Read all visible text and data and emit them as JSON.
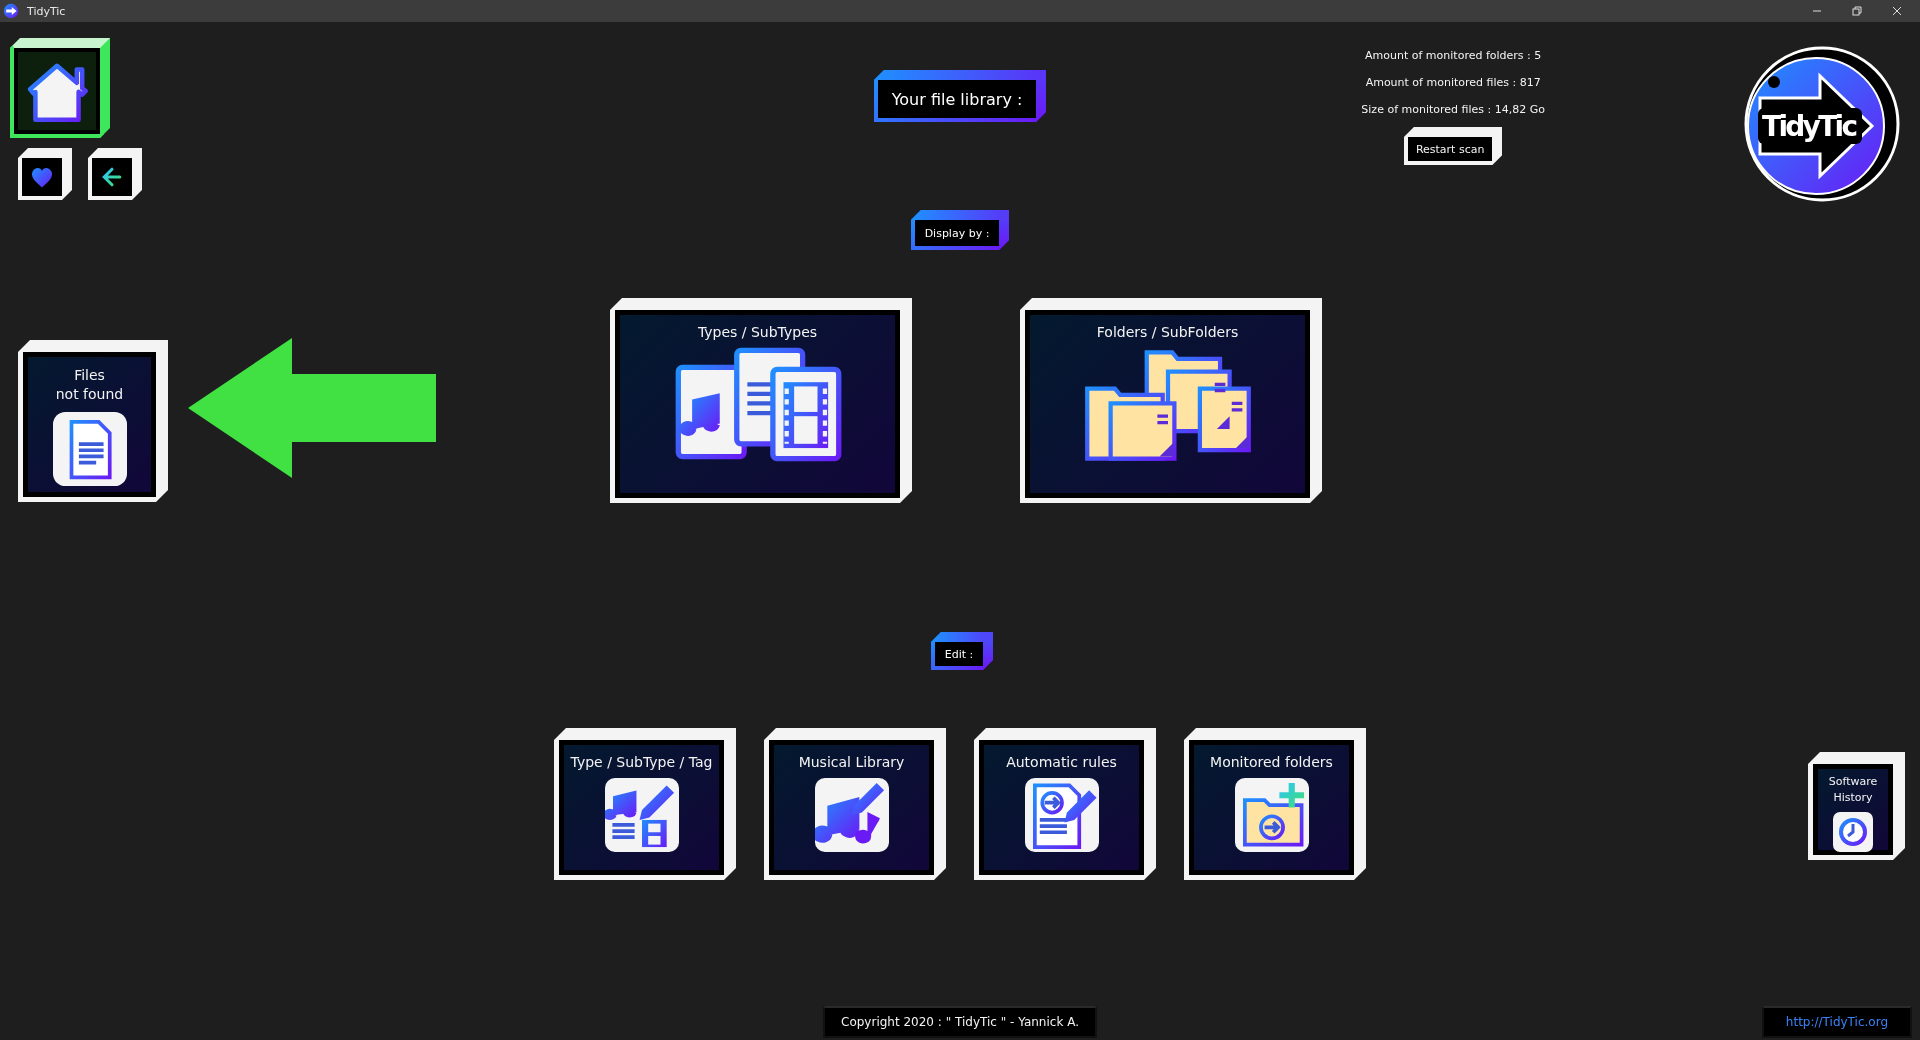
{
  "window": {
    "title": "TidyTic"
  },
  "nav": [
    {
      "kind": "home",
      "selected": true
    },
    {
      "kind": "favorites",
      "selected": false
    },
    {
      "kind": "back",
      "selected": false
    }
  ],
  "library_heading": "Your file library :",
  "stats": [
    "Amount of monitored folders : 5",
    "Amount of monitored files : 817",
    "Size of monitored files : 14,82 Go"
  ],
  "restart_button": "Restart scan",
  "logo": {
    "text": "TidyTic"
  },
  "display_heading": "Display by :",
  "files_not_found": {
    "label": "Files\nnot found"
  },
  "display_options": [
    {
      "kind": "types",
      "label": "Types / SubTypes"
    },
    {
      "kind": "folders",
      "label": "Folders / SubFolders"
    }
  ],
  "edit_heading": "Edit :",
  "edit_options": [
    {
      "kind": "tags",
      "label": "Type / SubType / Tag"
    },
    {
      "kind": "music",
      "label": "Musical Library"
    },
    {
      "kind": "rules",
      "label": "Automatic rules"
    },
    {
      "kind": "monitored",
      "label": "Monitored folders"
    }
  ],
  "software_history": {
    "label": "Software\nHistory"
  },
  "footer": {
    "copyright": "Copyright 2020 : \" TidyTic \" - Yannick A.",
    "link": "http://TidyTic.org"
  }
}
